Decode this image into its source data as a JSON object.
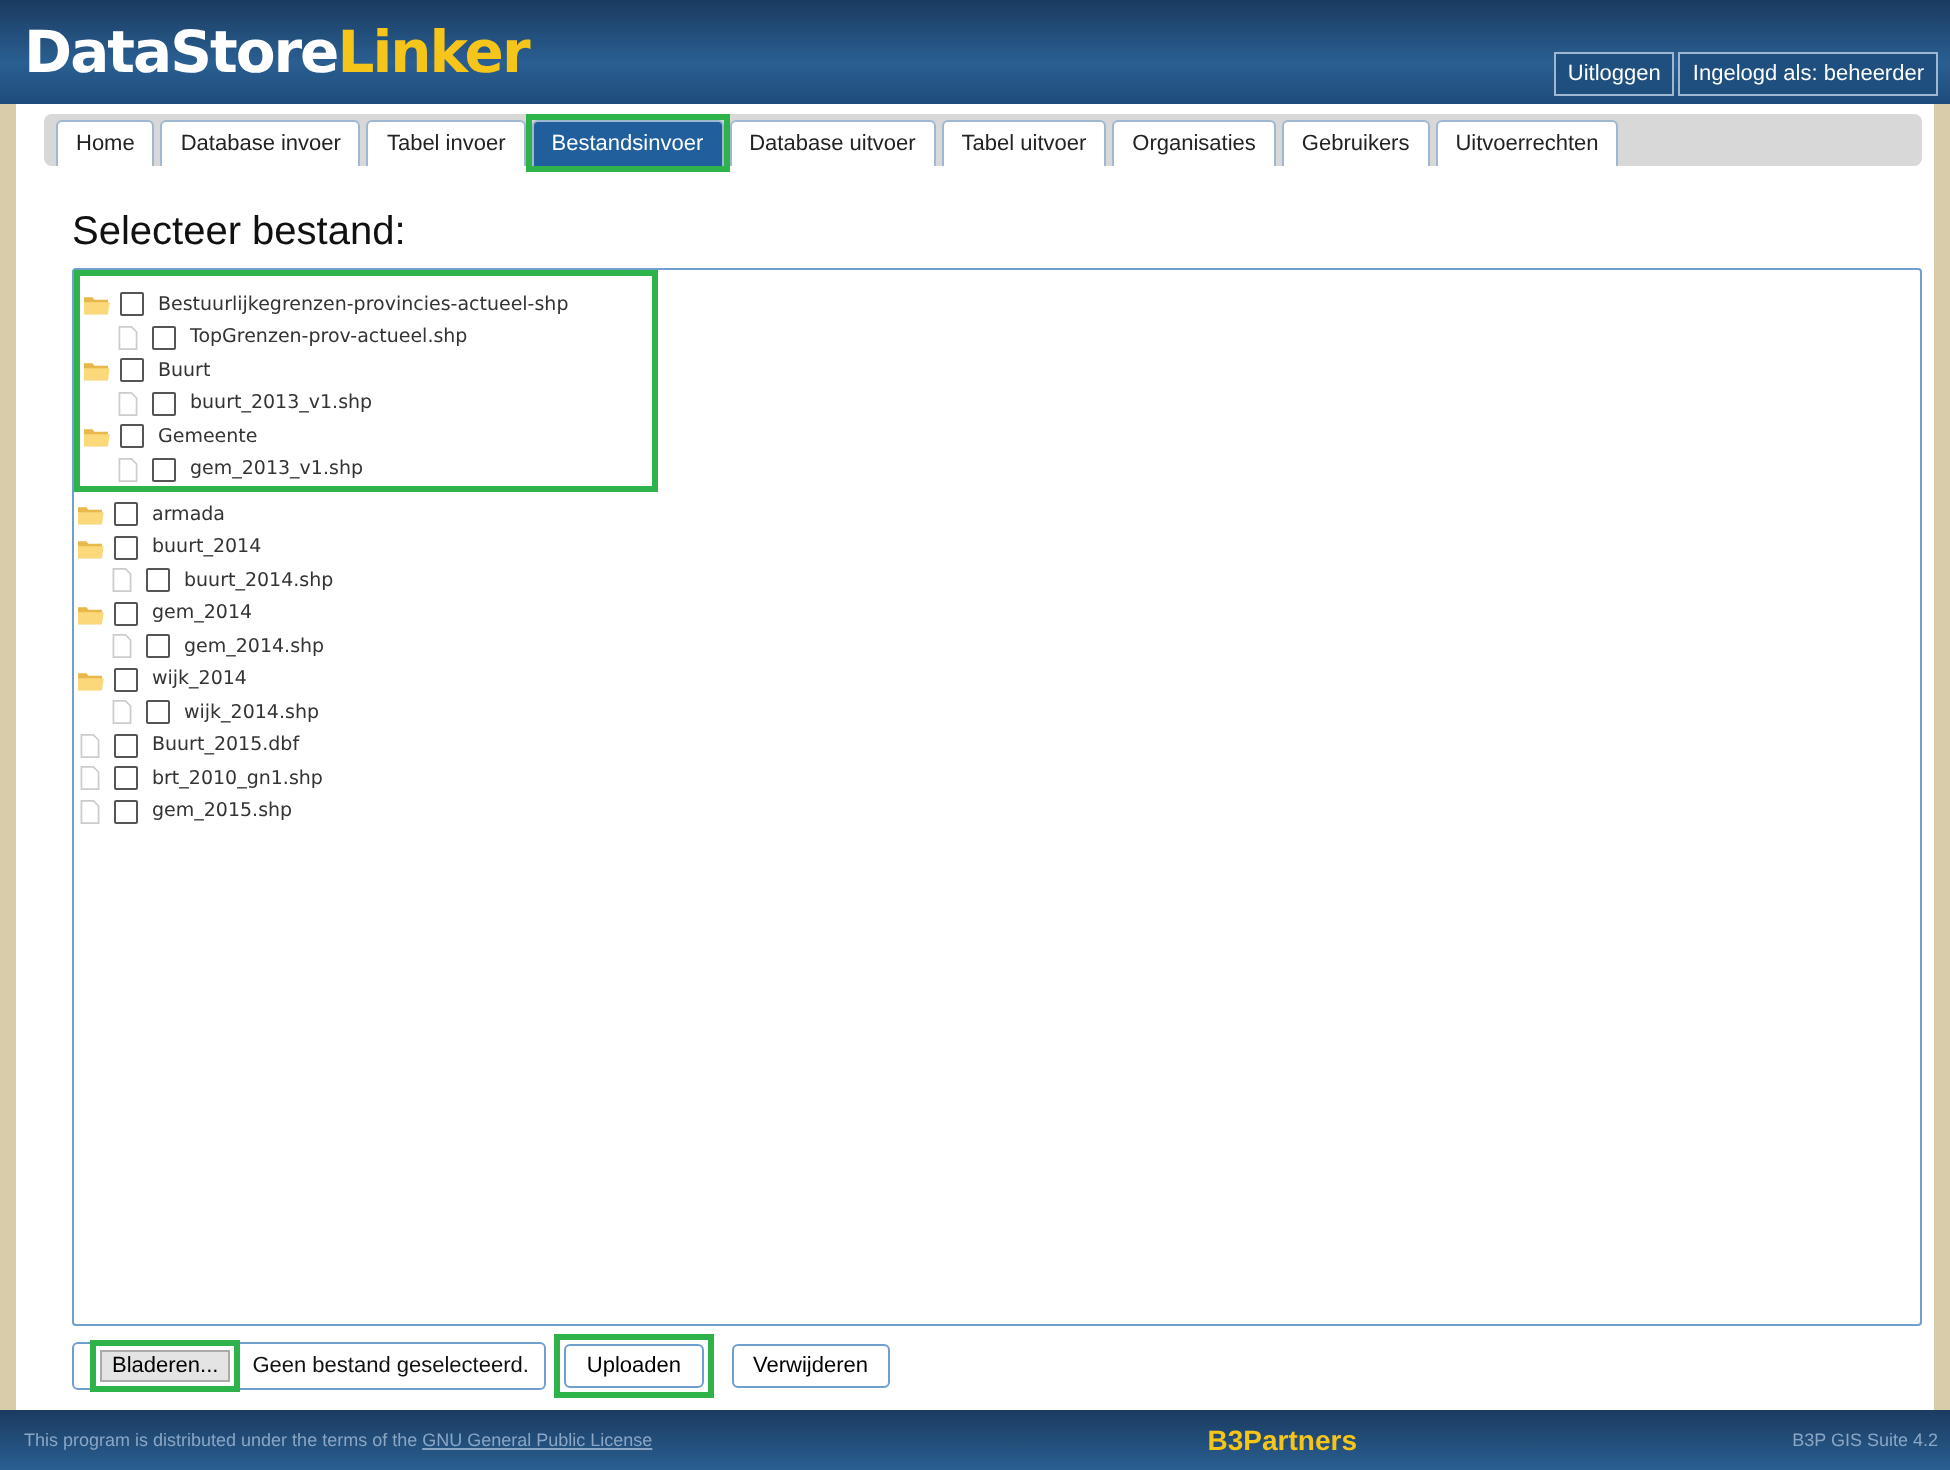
{
  "header": {
    "logo_part1": "DataStore",
    "logo_part2": "Linker",
    "links": [
      "Uitloggen",
      "Ingelogd als: beheerder"
    ]
  },
  "tabs": [
    {
      "label": "Home",
      "selected": false,
      "highlighted": false
    },
    {
      "label": "Database invoer",
      "selected": false,
      "highlighted": false
    },
    {
      "label": "Tabel invoer",
      "selected": false,
      "highlighted": false
    },
    {
      "label": "Bestandsinvoer",
      "selected": true,
      "highlighted": true
    },
    {
      "label": "Database uitvoer",
      "selected": false,
      "highlighted": false
    },
    {
      "label": "Tabel uitvoer",
      "selected": false,
      "highlighted": false
    },
    {
      "label": "Organisaties",
      "selected": false,
      "highlighted": false
    },
    {
      "label": "Gebruikers",
      "selected": false,
      "highlighted": false
    },
    {
      "label": "Uitvoerrechten",
      "selected": false,
      "highlighted": false
    }
  ],
  "heading": "Selecteer bestand:",
  "tree": [
    {
      "kind": "folder",
      "name": "Bestuurlijkegrenzen-provincies-actueel-shp",
      "checked": false,
      "highlighted": true,
      "children": [
        {
          "kind": "file",
          "name": "TopGrenzen-prov-actueel.shp",
          "checked": false
        }
      ]
    },
    {
      "kind": "folder",
      "name": "Buurt",
      "checked": false,
      "highlighted": true,
      "children": [
        {
          "kind": "file",
          "name": "buurt_2013_v1.shp",
          "checked": false
        }
      ]
    },
    {
      "kind": "folder",
      "name": "Gemeente",
      "checked": false,
      "highlighted": true,
      "children": [
        {
          "kind": "file",
          "name": "gem_2013_v1.shp",
          "checked": false
        }
      ]
    },
    {
      "kind": "folder",
      "name": "armada",
      "checked": false,
      "highlighted": false
    },
    {
      "kind": "folder",
      "name": "buurt_2014",
      "checked": false,
      "highlighted": false,
      "children": [
        {
          "kind": "file",
          "name": "buurt_2014.shp",
          "checked": false
        }
      ]
    },
    {
      "kind": "folder",
      "name": "gem_2014",
      "checked": false,
      "highlighted": false,
      "children": [
        {
          "kind": "file",
          "name": "gem_2014.shp",
          "checked": false
        }
      ]
    },
    {
      "kind": "folder",
      "name": "wijk_2014",
      "checked": false,
      "highlighted": false,
      "children": [
        {
          "kind": "file",
          "name": "wijk_2014.shp",
          "checked": false
        }
      ]
    },
    {
      "kind": "file",
      "name": "Buurt_2015.dbf",
      "checked": false,
      "highlighted": false
    },
    {
      "kind": "file",
      "name": "brt_2010_gn1.shp",
      "checked": false,
      "highlighted": false
    },
    {
      "kind": "file",
      "name": "gem_2015.shp",
      "checked": false,
      "highlighted": false
    }
  ],
  "file_input": {
    "button": "Bladeren...",
    "status": "Geen bestand geselecteerd.",
    "highlighted": true
  },
  "buttons": [
    {
      "label": "Uploaden",
      "highlighted": true
    },
    {
      "label": "Verwijderen",
      "highlighted": false
    }
  ],
  "footer": {
    "license_text": "This program is distributed under the terms of the",
    "license_link": "GNU General Public License",
    "brand": "B3Partners",
    "version": "B3P GIS Suite 4.2"
  }
}
